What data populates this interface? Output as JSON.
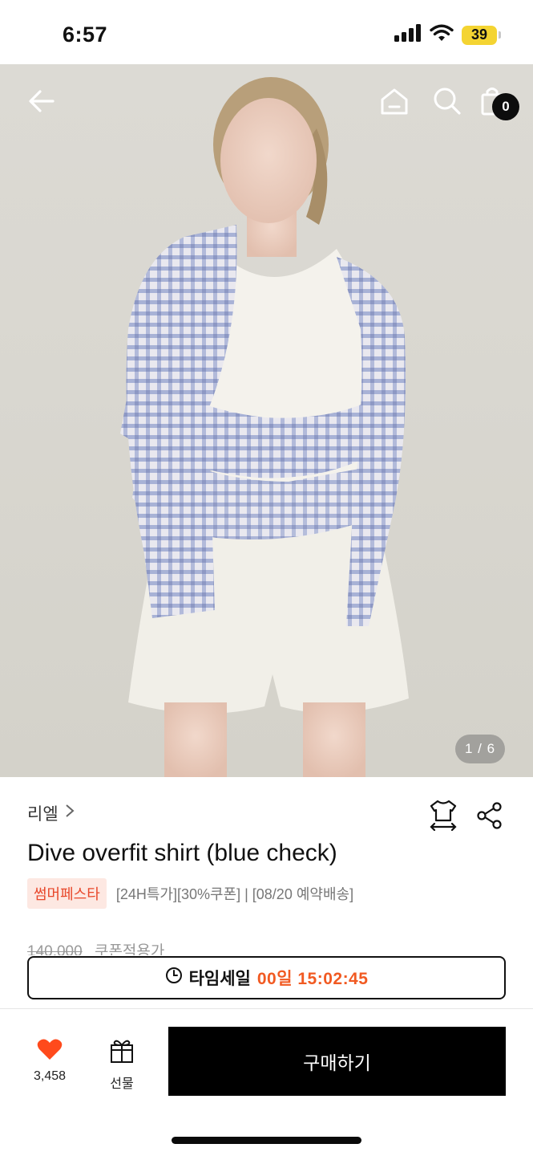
{
  "status_bar": {
    "time": "6:57",
    "battery": "39",
    "icons": [
      "signal-icon",
      "wifi-icon",
      "battery-icon"
    ]
  },
  "hero": {
    "icons": [
      "back-arrow-icon",
      "home-icon",
      "search-icon",
      "cart-icon"
    ],
    "cart_count": "0",
    "page_indicator": "1 / 6"
  },
  "product": {
    "brand": "리엘",
    "title": "Dive overfit shirt (blue check)",
    "promo_badge": "썸머페스타",
    "promo_text": "[24H특가][30%쿠폰] | [08/20 예약배송]",
    "original_price": "140,000",
    "coupon_label": "쿠폰적용가"
  },
  "timesale": {
    "label": "타임세일",
    "time": "00일 15:02:45"
  },
  "bottom_bar": {
    "like_count": "3,458",
    "gift_label": "선물",
    "buy_label": "구매하기"
  },
  "colors": {
    "accent": "#f15a22",
    "like_heart": "#ff4a1c",
    "promo_badge_bg": "#fde8e2",
    "promo_badge_text": "#e8472a",
    "battery": "#f4d432"
  }
}
